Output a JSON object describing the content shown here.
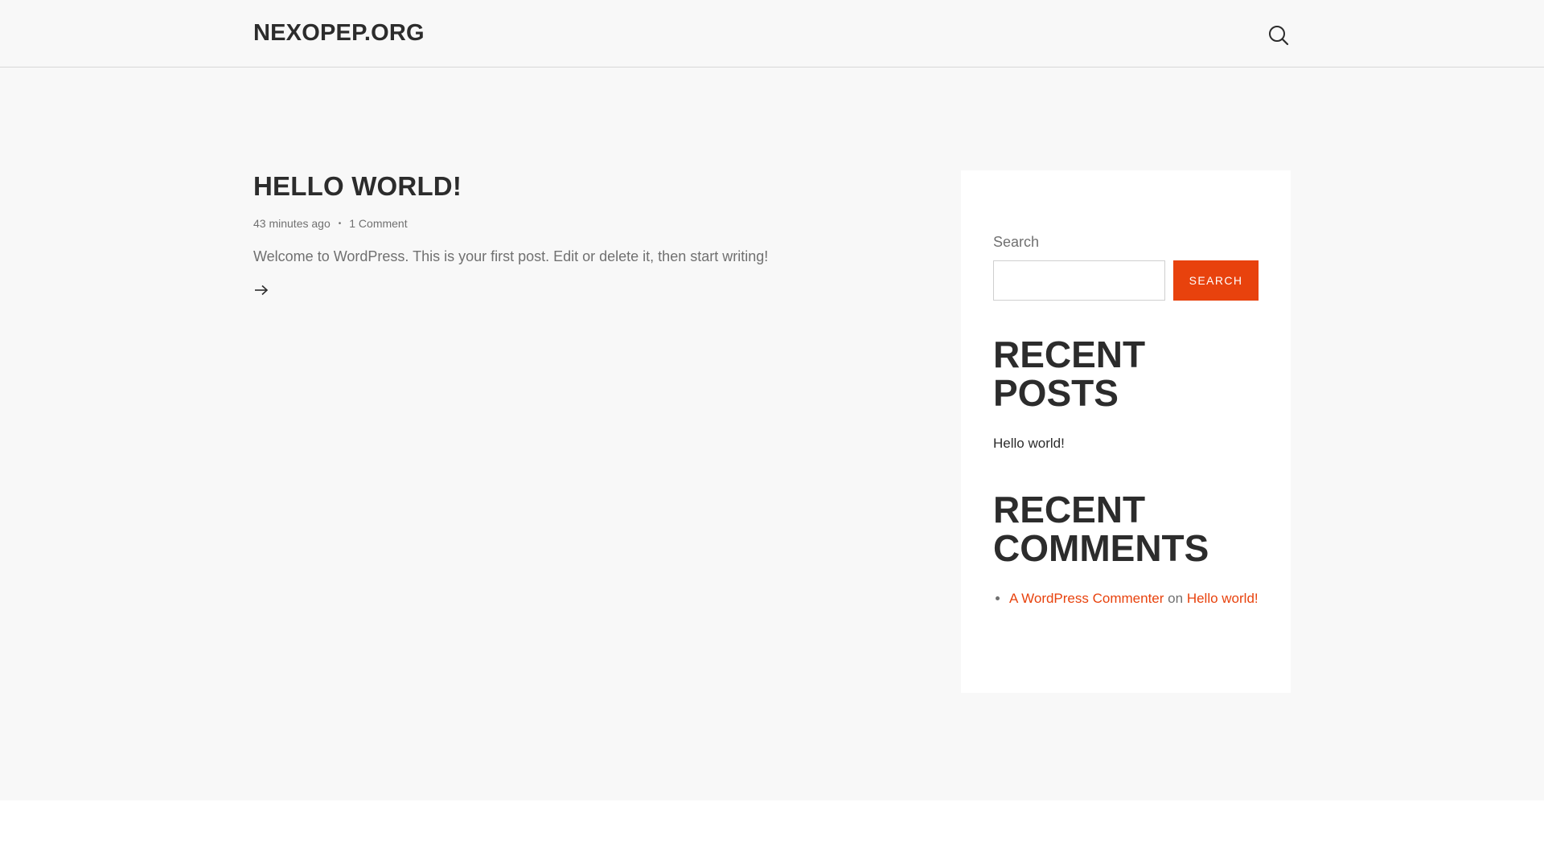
{
  "header": {
    "site_title": "NEXOPEP.ORG",
    "search_icon": "search-icon"
  },
  "post": {
    "title": "HELLO WORLD!",
    "time": "43 minutes ago",
    "separator": "•",
    "comments": "1 Comment",
    "excerpt": "Welcome to WordPress. This is your first post. Edit or delete it, then start writing!",
    "read_more_icon": "arrow-right-icon"
  },
  "sidebar": {
    "search": {
      "label": "Search",
      "value": "",
      "button_label": "SEARCH"
    },
    "recent_posts": {
      "title": "RECENT POSTS",
      "items": [
        "Hello world!"
      ]
    },
    "recent_comments": {
      "title": "RECENT COMMENTS",
      "items": [
        {
          "author": "A WordPress Commenter",
          "connector": "on",
          "post": "Hello world!"
        }
      ]
    }
  },
  "colors": {
    "accent": "#e8420d",
    "text_dark": "#2c2c2c",
    "text_muted": "#707070",
    "background": "#f8f8f8"
  }
}
